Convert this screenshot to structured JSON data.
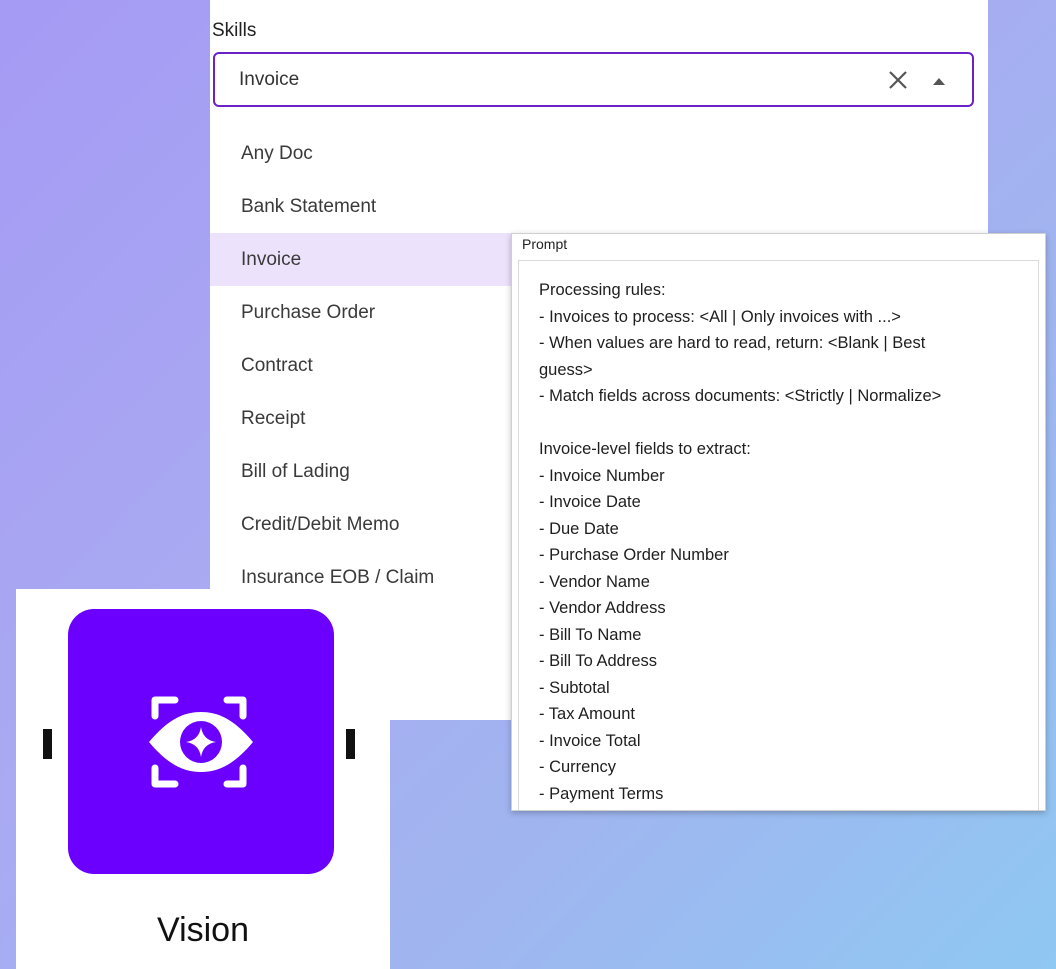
{
  "skills": {
    "label": "Skills",
    "selected_value": "Invoice",
    "clear_icon": "close-icon",
    "toggle_icon": "caret-up-icon",
    "options": [
      {
        "label": "Any Doc",
        "selected": false
      },
      {
        "label": "Bank Statement",
        "selected": false
      },
      {
        "label": "Invoice",
        "selected": true
      },
      {
        "label": "Purchase Order",
        "selected": false
      },
      {
        "label": "Contract",
        "selected": false
      },
      {
        "label": "Receipt",
        "selected": false
      },
      {
        "label": "Bill of Lading",
        "selected": false
      },
      {
        "label": "Credit/Debit Memo",
        "selected": false
      },
      {
        "label": "Insurance EOB / Claim",
        "selected": false
      }
    ],
    "accent_color": "#6b21c8",
    "selected_bg": "#ece2fc"
  },
  "prompt": {
    "label": "Prompt",
    "lines": [
      "Processing rules:",
      "- Invoices to process: <All | Only invoices with ...>",
      "- When values are hard to read, return: <Blank | Best",
      "guess>",
      "- Match fields across documents: <Strictly | Normalize>",
      "",
      "Invoice-level fields to extract:",
      "- Invoice Number",
      "- Invoice Date",
      "- Due Date",
      "- Purchase Order Number",
      "- Vendor Name",
      "- Vendor Address",
      "- Bill To Name",
      "- Bill To Address",
      "- Subtotal",
      "- Tax Amount",
      "- Invoice Total",
      "- Currency",
      "- Payment Terms"
    ]
  },
  "vision_node": {
    "label": "Vision",
    "icon": "vision-eye-icon",
    "tile_color": "#6b00ff"
  }
}
